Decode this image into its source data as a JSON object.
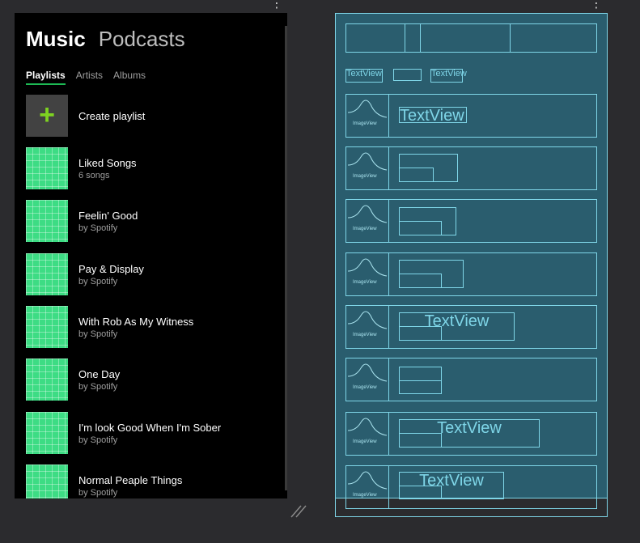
{
  "design": {
    "header": {
      "title": "Music",
      "secondary": "Podcasts"
    },
    "tabs": [
      "Playlists",
      "Artists",
      "Albums"
    ],
    "create": {
      "icon": "+",
      "label": "Create playlist"
    },
    "items": [
      {
        "title": "Liked Songs",
        "subtitle": "6 songs"
      },
      {
        "title": "Feelin' Good",
        "subtitle": "by Spotify"
      },
      {
        "title": "Pay & Display",
        "subtitle": "by Spotify"
      },
      {
        "title": "With Rob As My Witness",
        "subtitle": "by Spotify"
      },
      {
        "title": "One Day",
        "subtitle": "by Spotify"
      },
      {
        "title": "I'm look Good When I'm Sober",
        "subtitle": "by Spotify"
      },
      {
        "title": "Normal Peaple Things",
        "subtitle": "by Spotify"
      }
    ]
  },
  "blueprint": {
    "textview_label": "TextView",
    "imageview_label": "ImageView"
  },
  "colors": {
    "accent": "#1db954",
    "blueprint_bg": "#2a5d6e",
    "blueprint_line": "#7fd6e8",
    "thumb": "#3ddc84"
  }
}
